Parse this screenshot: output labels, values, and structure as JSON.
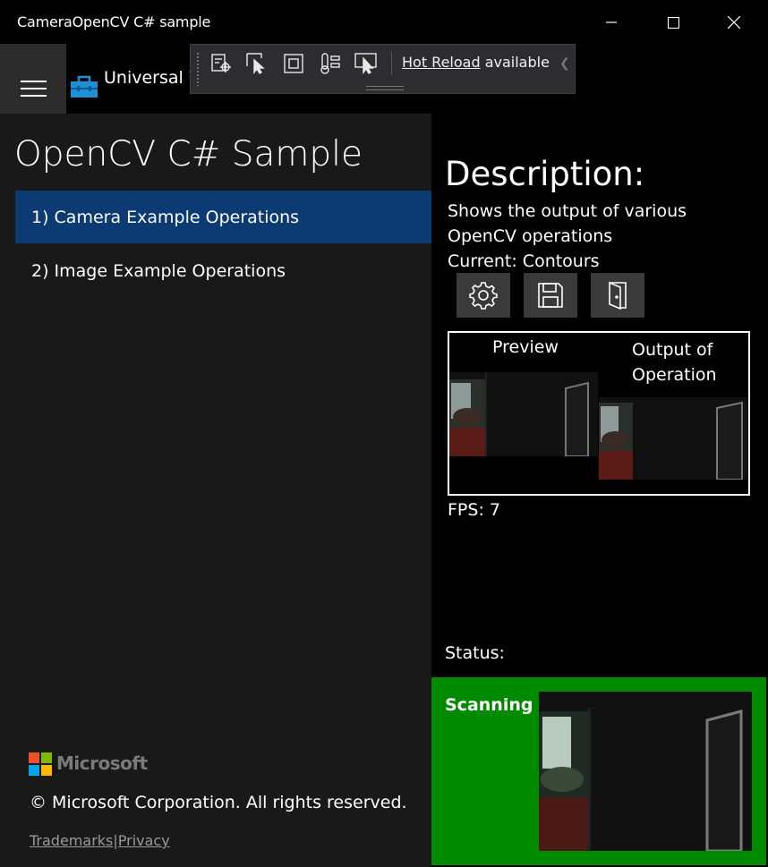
{
  "window": {
    "title": "CameraOpenCV C# sample"
  },
  "app": {
    "name": "Universal W"
  },
  "devtools": {
    "tools": [
      "live-visual-tree-icon",
      "select-element-icon",
      "display-layout-adorners-icon",
      "track-focus-icon",
      "preview-selection-icon"
    ],
    "hot_reload_link": "Hot Reload",
    "hot_reload_text": " available"
  },
  "sidebar": {
    "title": "OpenCV C# Sample",
    "items": [
      {
        "label": "1) Camera Example Operations",
        "selected": true
      },
      {
        "label": "2) Image Example Operations",
        "selected": false
      }
    ],
    "brand": "Microsoft",
    "copyright": "© Microsoft Corporation. All rights reserved.",
    "links": [
      "Trademarks",
      "Privacy"
    ],
    "link_separator": "|"
  },
  "content": {
    "description_title": "Description:",
    "description_lines": [
      "Shows the output of various",
      "OpenCV operations",
      "Current: Contours"
    ],
    "actions": [
      "settings-icon",
      "save-icon",
      "exit-icon"
    ],
    "preview_label": "Preview",
    "output_label": "Output of Operation",
    "fps": "FPS: 7",
    "status_label": "Status:",
    "status_text": "Scanning ..."
  },
  "colors": {
    "selected": "#0c3a73",
    "status_bg": "#008a00",
    "pane": "#191919"
  }
}
